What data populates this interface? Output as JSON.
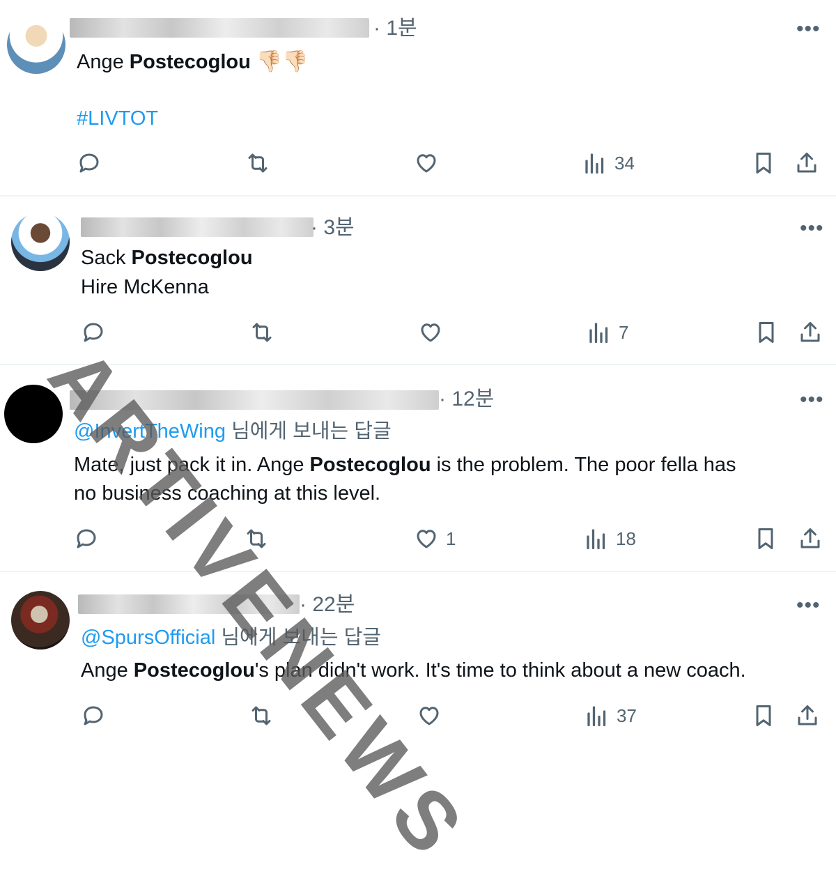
{
  "tweets": [
    {
      "time": "· 1분",
      "line1_pre": "Ange ",
      "line1_bold": "Postecoglou",
      "emoji": "👎🏻👎🏻",
      "hashtag": "#LIVTOT",
      "views": "34"
    },
    {
      "time": "· 3분",
      "line1_pre": "Sack ",
      "line1_bold": "Postecoglou",
      "line2": "Hire McKenna",
      "views": "7"
    },
    {
      "time": "· 12분",
      "reply_handle": "@InvertTheWing",
      "reply_suffix": " 님에게 보내는 답글",
      "text_pre": "Mate, just pack it in. Ange ",
      "text_bold": "Postecoglou",
      "text_post": " is the problem. The poor fella has",
      "text_line2": "no business  coaching at this level.",
      "likes": "1",
      "views": "18"
    },
    {
      "time": "· 22분",
      "reply_handle": "@SpursOfficial",
      "reply_suffix": " 님에게 보내는 답글",
      "text_pre": "Ange ",
      "text_bold": "Postecoglou",
      "text_post": "'s plan didn't work. It's time to think about a new coach.",
      "views": "37"
    }
  ],
  "more_label": "•••",
  "watermark": "ARTIVENEWS",
  "colors": {
    "link": "#1d9bf0",
    "muted": "#536471",
    "text": "#0f1419"
  }
}
